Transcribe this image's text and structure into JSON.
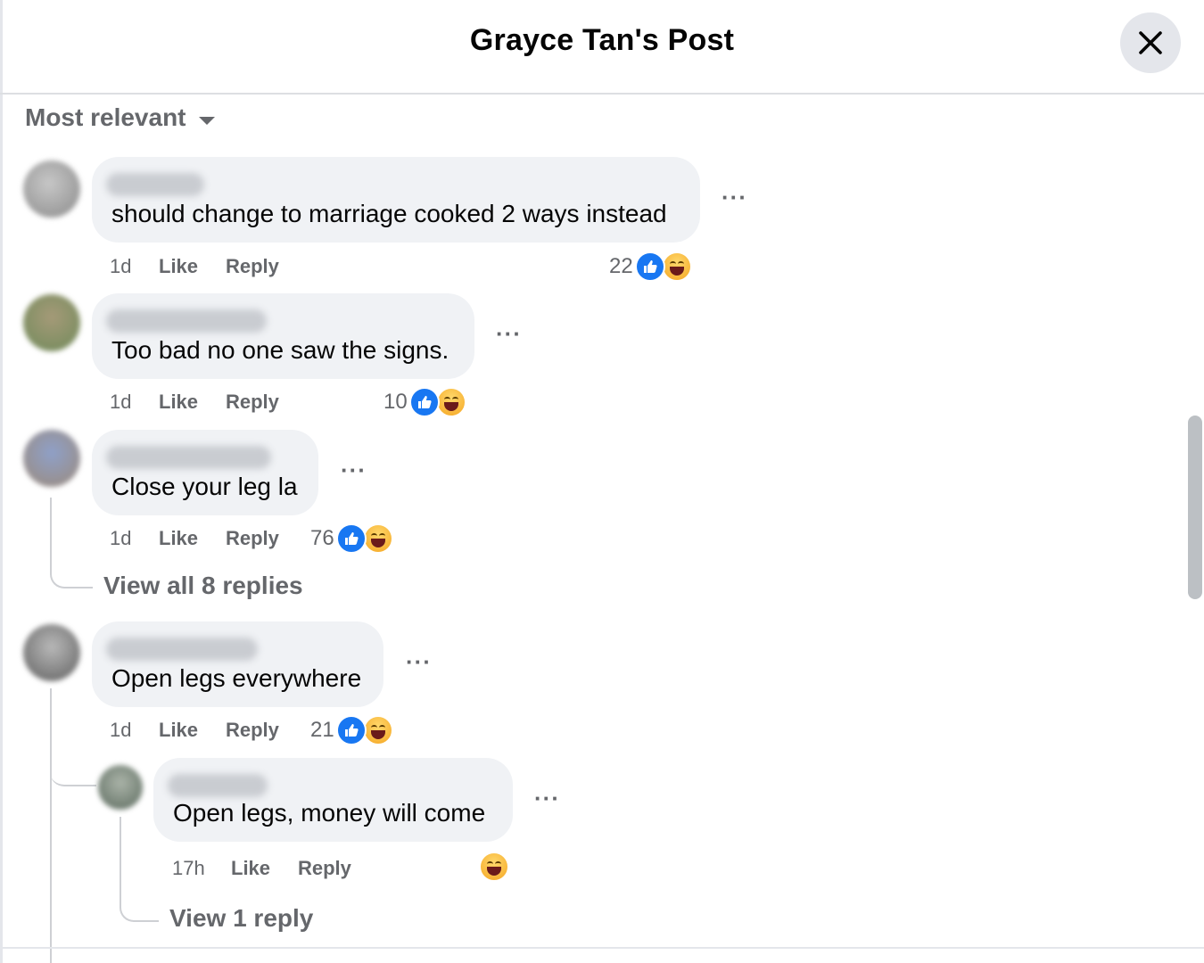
{
  "header": {
    "title": "Grayce Tan's Post"
  },
  "sort": {
    "label": "Most relevant"
  },
  "comments": [
    {
      "text": "should change to marriage cooked 2 ways instead",
      "time": "1d",
      "like": "Like",
      "reply": "Reply",
      "reactions": "22"
    },
    {
      "text": "Too bad no one saw the signs.",
      "time": "1d",
      "like": "Like",
      "reply": "Reply",
      "reactions": "10"
    },
    {
      "text": "Close your leg la",
      "time": "1d",
      "like": "Like",
      "reply": "Reply",
      "reactions": "76",
      "view_replies": "View all 8 replies"
    },
    {
      "text": "Open legs everywhere",
      "time": "1d",
      "like": "Like",
      "reply": "Reply",
      "reactions": "21"
    }
  ],
  "reply": {
    "text": "Open legs, money will come",
    "time": "17h",
    "like": "Like",
    "reply": "Reply",
    "view_replies": "View 1 reply"
  },
  "icons": [
    "close-icon",
    "caret-down-icon",
    "more-icon",
    "like-reaction-icon",
    "haha-reaction-icon"
  ]
}
